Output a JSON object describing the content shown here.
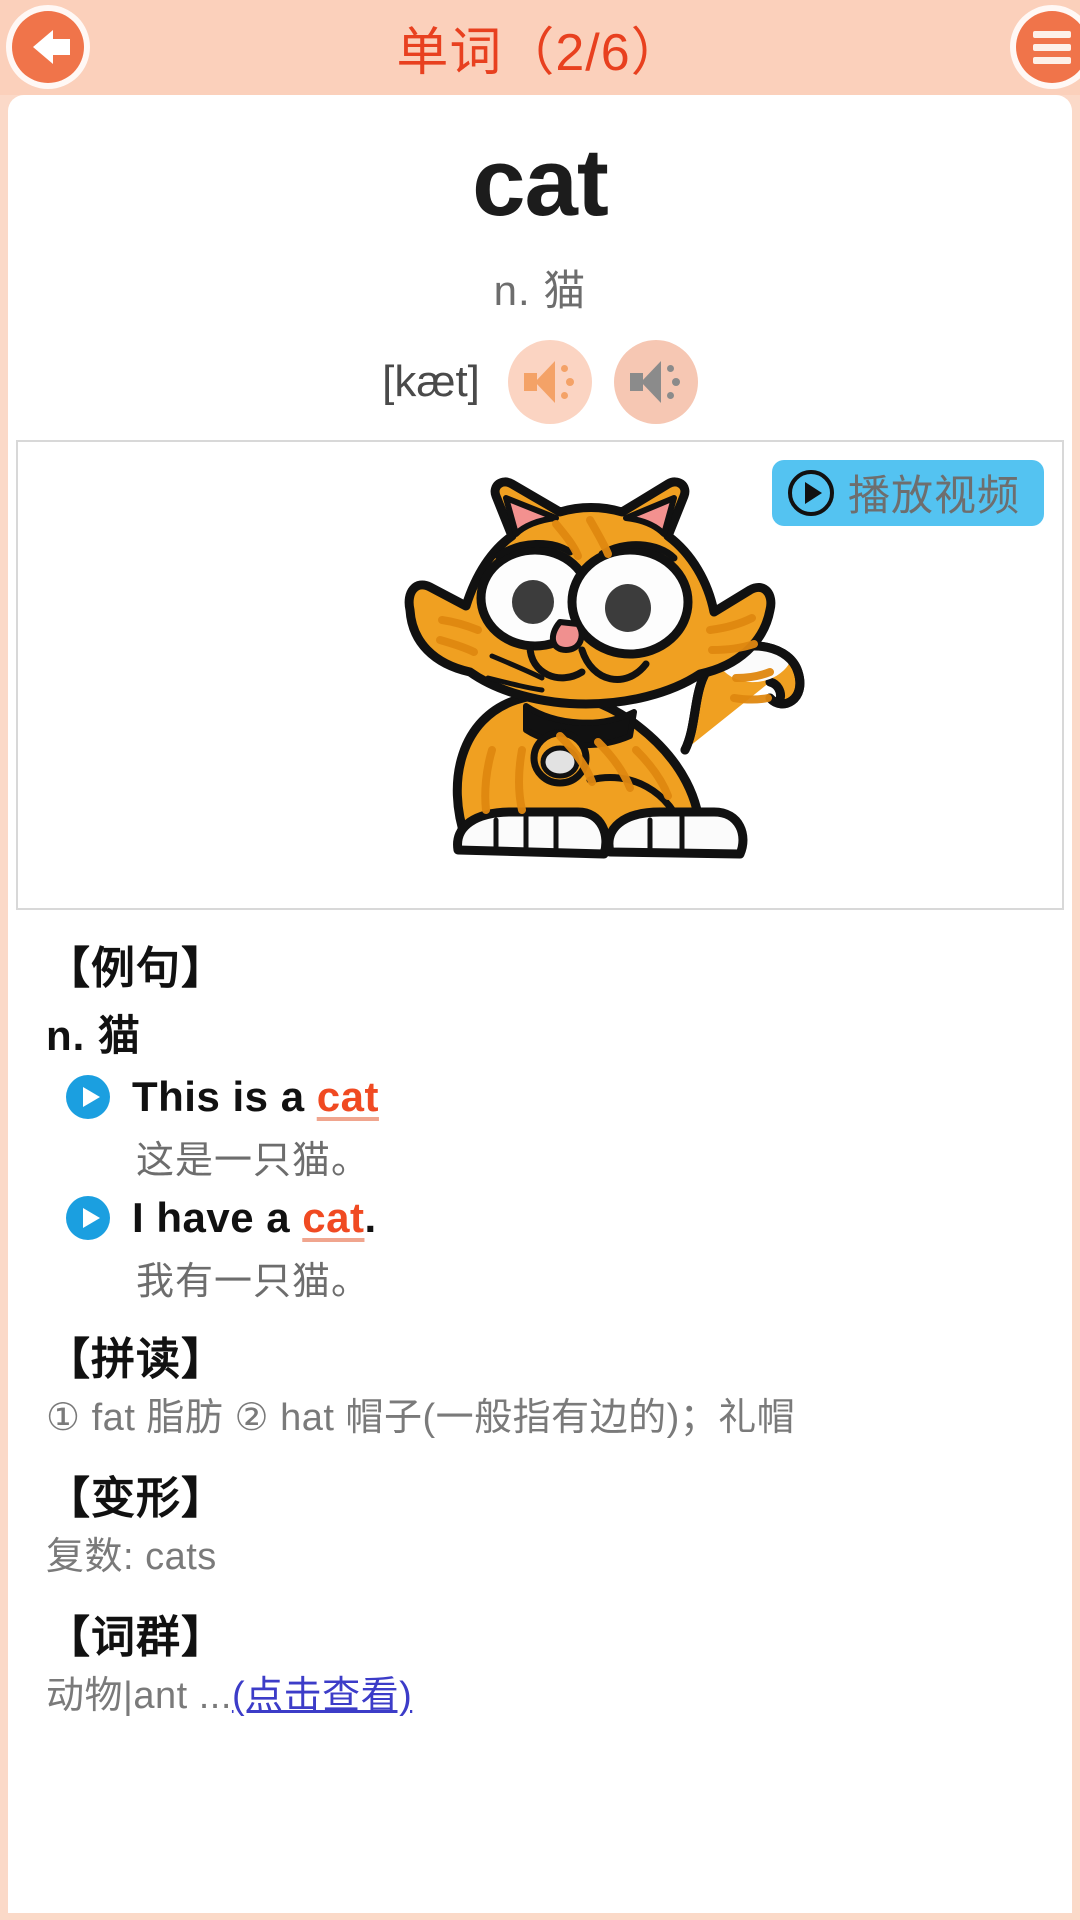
{
  "header": {
    "title": "单词（2/6）",
    "back_icon": "back-arrow-icon",
    "menu_icon": "hamburger-menu-icon",
    "accent_color": "#e8401f",
    "bar_color": "#fbd0bb",
    "button_color": "#f0744a"
  },
  "word": {
    "text": "cat",
    "part_of_speech": "n. 猫",
    "phonetic": "[kæt]",
    "speaker_primary_icon": "speaker-icon",
    "speaker_secondary_icon": "speaker-icon"
  },
  "media": {
    "play_video_label": "播放视频",
    "play_video_icon": "play-circle-icon",
    "play_video_color": "#54c3f1",
    "illustration": "orange-cartoon-cat"
  },
  "sections": {
    "examples": {
      "title": "【例句】",
      "pos": "n. 猫",
      "items": [
        {
          "en_prefix": "This is a ",
          "en_highlight": "cat",
          "en_suffix": "",
          "cn": "这是一只猫。",
          "play_icon": "play-icon"
        },
        {
          "en_prefix": "I have a ",
          "en_highlight": "cat",
          "en_suffix": ".",
          "cn": "我有一只猫。",
          "play_icon": "play-icon"
        }
      ]
    },
    "spelling": {
      "title": "【拼读】",
      "content": "① fat 脂肪 ② hat 帽子(一般指有边的)；礼帽"
    },
    "forms": {
      "title": "【变形】",
      "content": "复数: cats"
    },
    "word_group": {
      "title": "【词群】",
      "content": "动物|ant ...",
      "link_label": "(点击查看)",
      "link_color": "#3c3cc8"
    }
  }
}
